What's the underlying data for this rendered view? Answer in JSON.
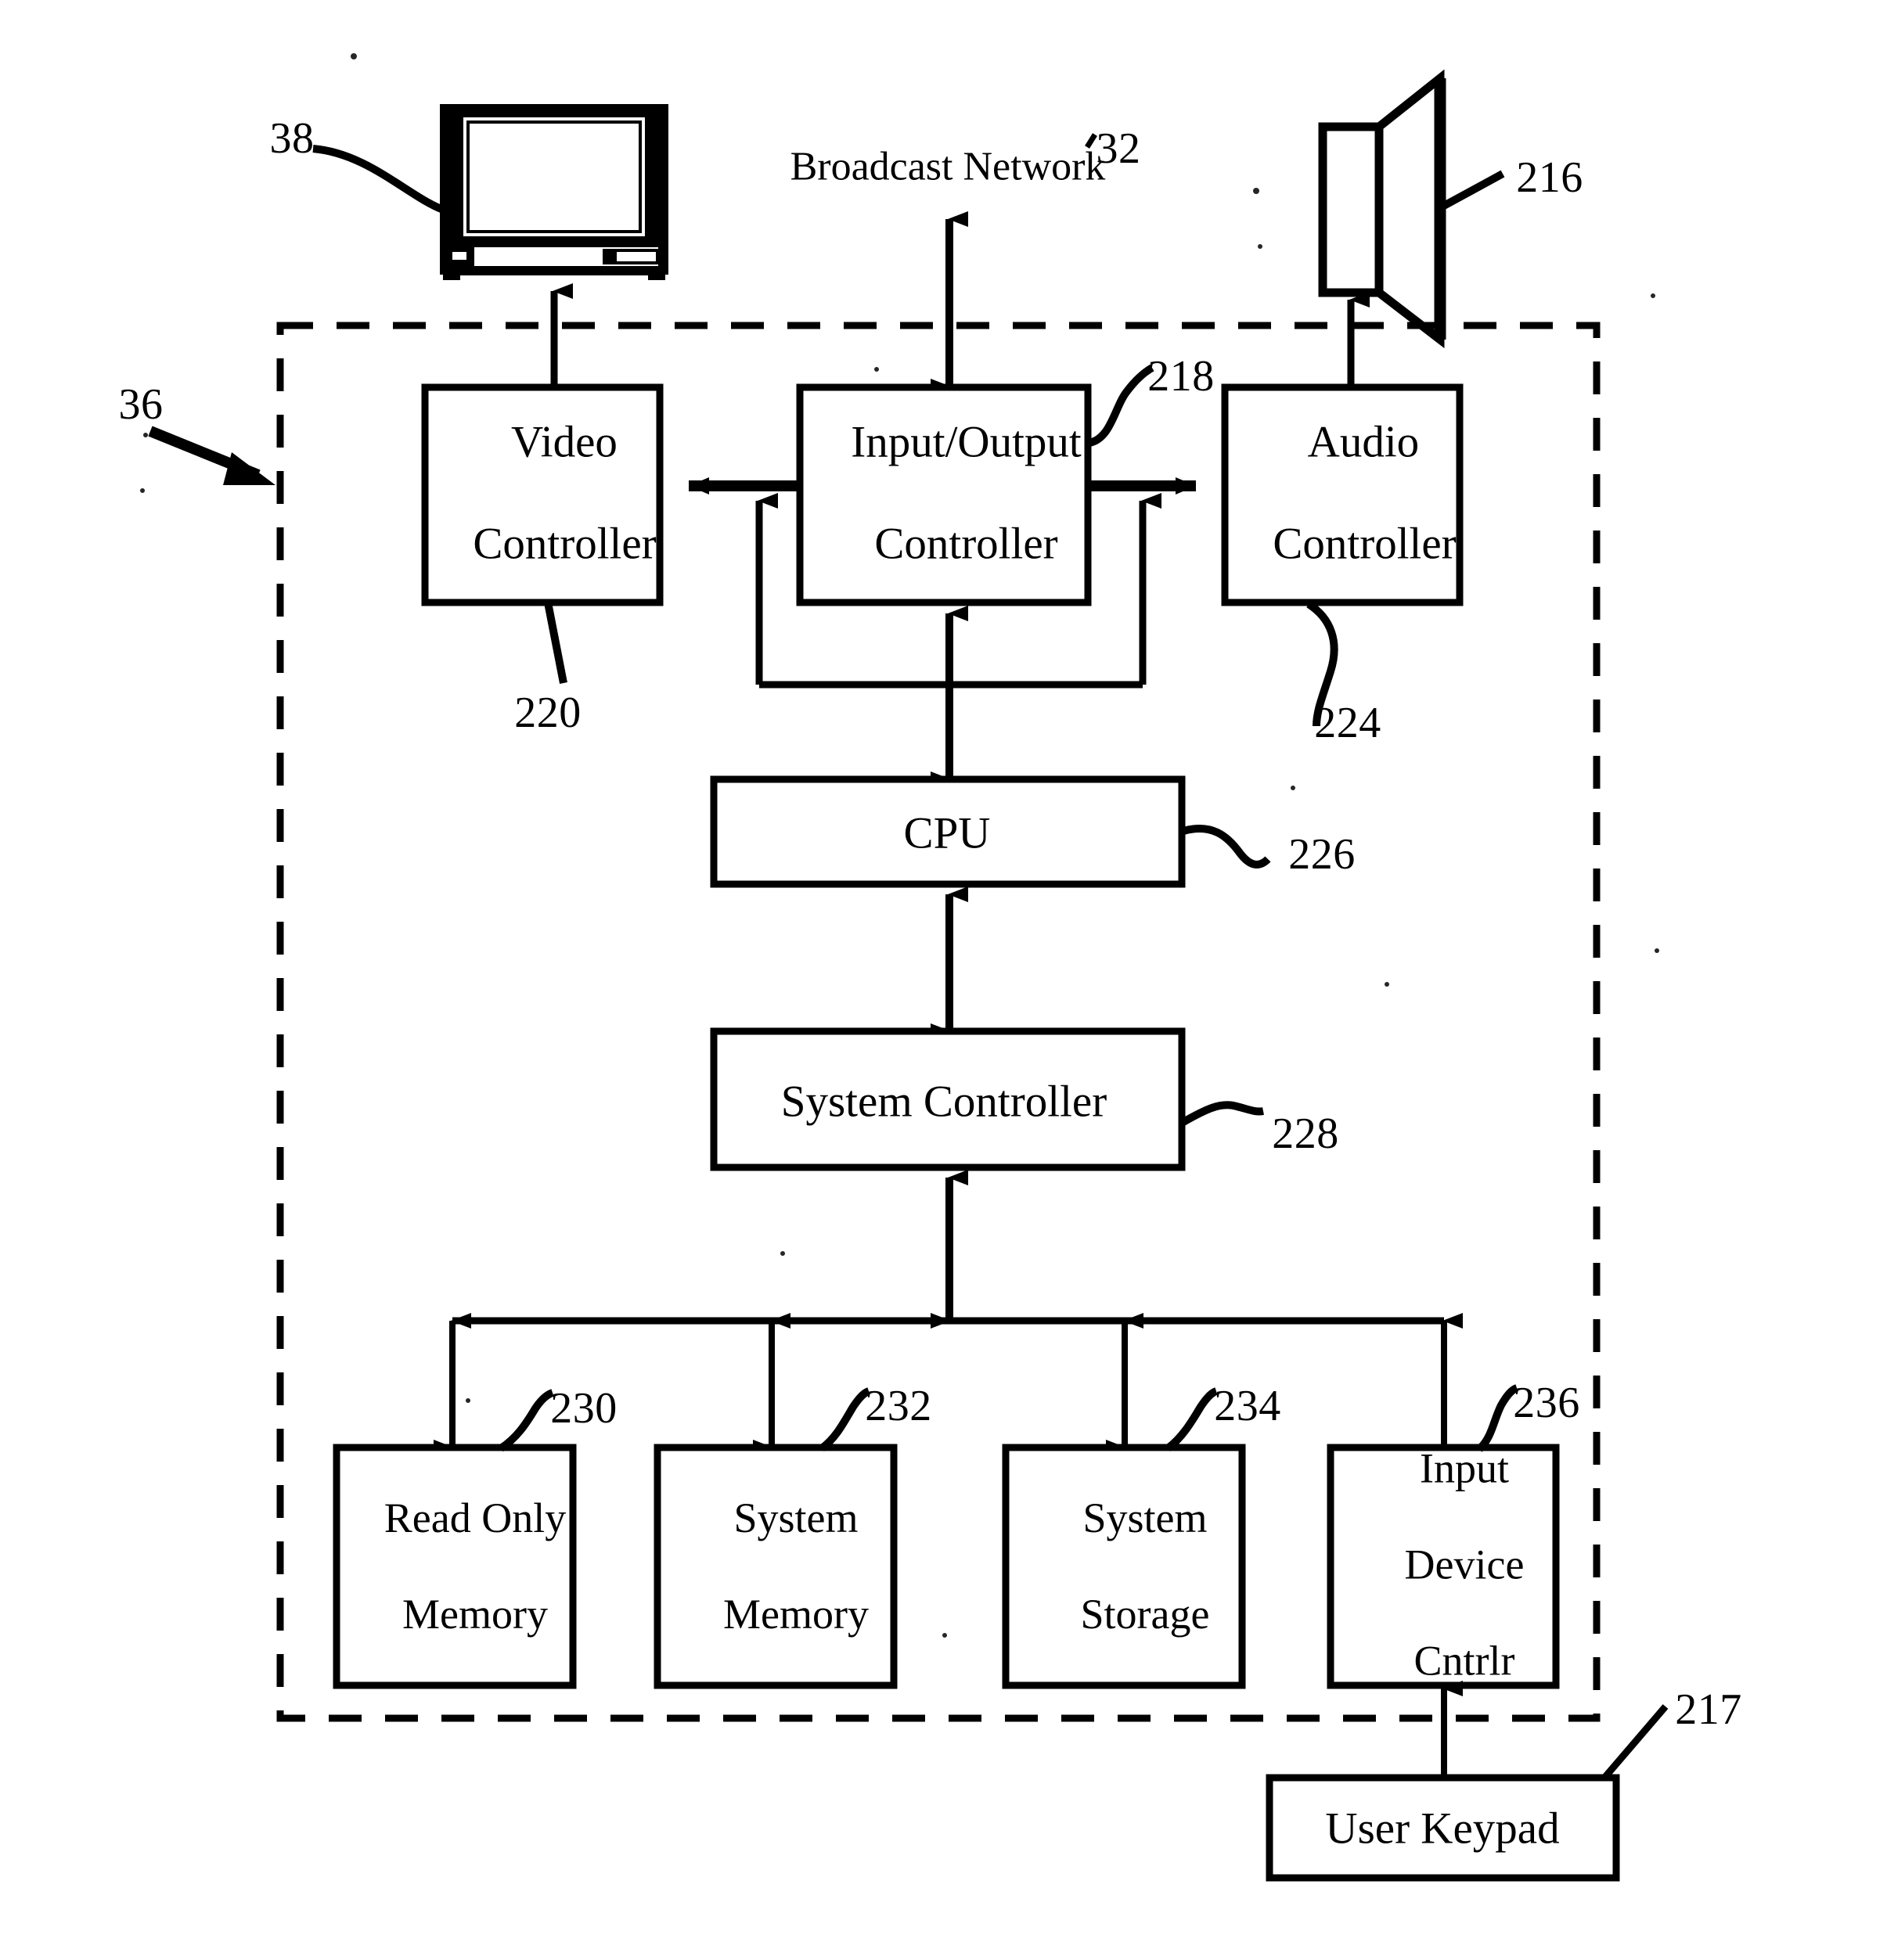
{
  "figure": {
    "type": "patent-block-diagram",
    "description": "Set-top box architecture block diagram"
  },
  "external": {
    "broadcast_network": {
      "label": "Broadcast Network",
      "ref": "32"
    },
    "television": {
      "ref": "38",
      "icon": "crt-television-icon"
    },
    "speaker": {
      "ref": "216",
      "icon": "loudspeaker-icon"
    },
    "user_keypad": {
      "label": "User Keypad",
      "ref": "217"
    },
    "enclosure": {
      "ref": "36"
    }
  },
  "blocks": [
    {
      "id": "video-controller",
      "label": "Video\nController",
      "ref": "220"
    },
    {
      "id": "io-controller",
      "label": "Input/Output\nController",
      "ref": "218"
    },
    {
      "id": "audio-controller",
      "label": "Audio\nController",
      "ref": "224"
    },
    {
      "id": "cpu",
      "label": "CPU",
      "ref": "226"
    },
    {
      "id": "system-controller",
      "label": "System Controller",
      "ref": "228"
    },
    {
      "id": "read-only-memory",
      "label": "Read Only\nMemory",
      "ref": "230"
    },
    {
      "id": "system-memory",
      "label": "System\nMemory",
      "ref": "232"
    },
    {
      "id": "system-storage",
      "label": "System\nStorage",
      "ref": "234"
    },
    {
      "id": "input-device-cntrlr",
      "label": "Input\nDevice\nCntrlr",
      "ref": "236"
    }
  ],
  "block_labels": {
    "video_controller_line1": "Video",
    "video_controller_line2": "Controller",
    "io_controller_line1": "Input/Output",
    "io_controller_line2": "Controller",
    "audio_controller_line1": "Audio",
    "audio_controller_line2": "Controller",
    "cpu": "CPU",
    "system_controller": "System Controller",
    "read_only_memory_line1": "Read Only",
    "read_only_memory_line2": "Memory",
    "system_memory_line1": "System",
    "system_memory_line2": "Memory",
    "system_storage_line1": "System",
    "system_storage_line2": "Storage",
    "input_device_line1": "Input",
    "input_device_line2": "Device",
    "input_device_line3": "Cntrlr",
    "user_keypad": "User Keypad",
    "broadcast_network": "Broadcast Network"
  },
  "reference_numerals": {
    "enclosure": "36",
    "television": "38",
    "broadcast_network": "32",
    "speaker": "216",
    "user_keypad": "217",
    "io_controller": "218",
    "video_controller": "220",
    "audio_controller": "224",
    "cpu": "226",
    "system_controller": "228",
    "read_only_memory": "230",
    "system_memory": "232",
    "system_storage": "234",
    "input_device_cntrlr": "236"
  },
  "colors": {
    "ink": "#000000",
    "paper": "#ffffff"
  }
}
